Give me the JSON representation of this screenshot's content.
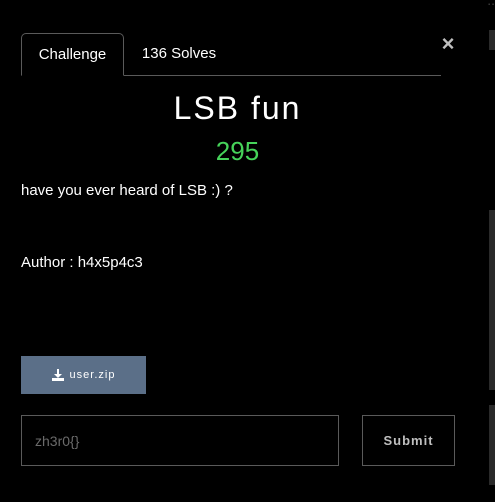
{
  "background": {
    "nav_left": "...",
    "nav_right": "..."
  },
  "tabs": [
    {
      "label": "Challenge",
      "active": true
    },
    {
      "label": "136 Solves",
      "active": false
    }
  ],
  "challenge": {
    "title": "LSB fun",
    "points": "295",
    "description": "have you ever heard of LSB :) ?",
    "author": "Author : h4x5p4c3"
  },
  "file": {
    "label": "user.zip",
    "icon": "download-icon"
  },
  "flag_form": {
    "placeholder": "zh3r0{}",
    "value": "",
    "submit_label": "Submit"
  },
  "colors": {
    "points": "#46d35a",
    "file_button": "#5b6f88",
    "background": "#000000"
  }
}
